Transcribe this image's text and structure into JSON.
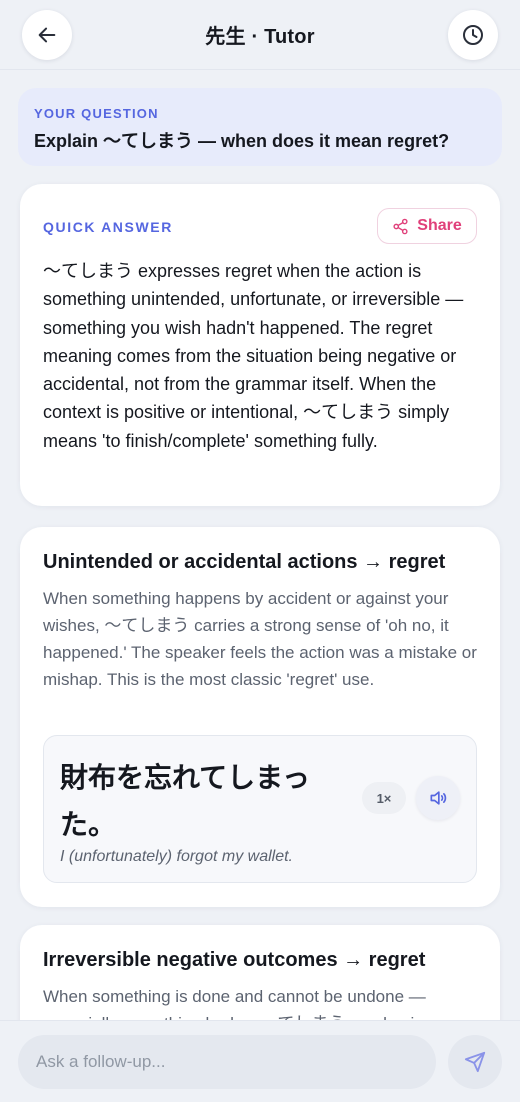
{
  "header": {
    "title": "先生 · Tutor",
    "back_icon": "arrow-left-icon",
    "history_icon": "clock-icon"
  },
  "question": {
    "label": "YOUR QUESTION",
    "text": "Explain ～てしまう — when does it mean regret?"
  },
  "quick_answer": {
    "label": "QUICK ANSWER",
    "share_label": "Share",
    "share_icon": "share-icon",
    "text": "～てしまう expresses regret when the action is something unintended, unfortunate, or irreversible — something you wish hadn't happened. The regret meaning comes from the situation being negative or accidental, not from the grammar itself. When the context is positive or intentional, ～てしまう simply means 'to finish/complete' something fully."
  },
  "sections": [
    {
      "title": "Unintended or accidental actions → regret",
      "body": "When something happens by accident or against your wishes, ～てしまう carries a strong sense of 'oh no, it happened.' The speaker feels the action was a mistake or mishap. This is the most classic 'regret' use.",
      "example": {
        "japanese": "財布を忘れてしまった。",
        "translation": "I (unfortunately) forgot my wallet.",
        "speed_label": "1×",
        "audio_icon": "speaker-icon"
      }
    },
    {
      "title": "Irreversible negative outcomes → regret",
      "body": "When something is done and cannot be undone — especially something bad — ～てしまう emphasizes"
    }
  ],
  "composer": {
    "placeholder": "Ask a follow-up...",
    "send_icon": "send-icon"
  },
  "colors": {
    "accent": "#5566e0",
    "share": "#e0407a",
    "background": "#eef1f6"
  }
}
